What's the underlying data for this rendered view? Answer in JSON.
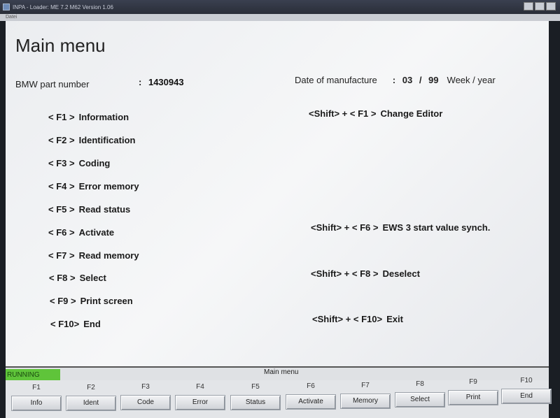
{
  "window": {
    "title": "INPA - Loader: ME 7.2 M62 Version 1.06",
    "menu_label": "Datei"
  },
  "screen": {
    "title": "Main menu",
    "part_number_label": "BMW part number",
    "part_number_sep": ":",
    "part_number_value": "1430943",
    "date_label": "Date of manufacture",
    "date_sep": ":",
    "date_value": "03  /  99",
    "date_unit": "Week / year"
  },
  "menu_left": [
    {
      "key": "< F1 >",
      "label": "Information"
    },
    {
      "key": "< F2 >",
      "label": "Identification"
    },
    {
      "key": "< F3 >",
      "label": "Coding"
    },
    {
      "key": "< F4 >",
      "label": "Error memory"
    },
    {
      "key": "< F5 >",
      "label": "Read status"
    },
    {
      "key": "< F6 >",
      "label": "Activate"
    },
    {
      "key": "< F7 >",
      "label": "Read memory"
    },
    {
      "key": "< F8 >",
      "label": "Select"
    },
    {
      "key": "< F9 >",
      "label": "Print screen"
    },
    {
      "key": "< F10>",
      "label": "End"
    }
  ],
  "menu_right": [
    {
      "key": "<Shift> + < F1 >",
      "label": "Change Editor"
    },
    {
      "key": "<Shift> + < F6 >",
      "label": "EWS 3 start value synch."
    },
    {
      "key": "<Shift> + < F8 >",
      "label": "Deselect"
    },
    {
      "key": "<Shift> + < F10>",
      "label": "Exit"
    }
  ],
  "status": {
    "state": "RUNNING",
    "title": "Main menu",
    "state_color": "#5fc43a"
  },
  "fkeys": [
    {
      "num": "F1",
      "label": "Info"
    },
    {
      "num": "F2",
      "label": "Ident"
    },
    {
      "num": "F3",
      "label": "Code"
    },
    {
      "num": "F4",
      "label": "Error"
    },
    {
      "num": "F5",
      "label": "Status"
    },
    {
      "num": "F6",
      "label": "Activate"
    },
    {
      "num": "F7",
      "label": "Memory"
    },
    {
      "num": "F8",
      "label": "Select"
    },
    {
      "num": "F9",
      "label": "Print"
    },
    {
      "num": "F10",
      "label": "End"
    }
  ]
}
